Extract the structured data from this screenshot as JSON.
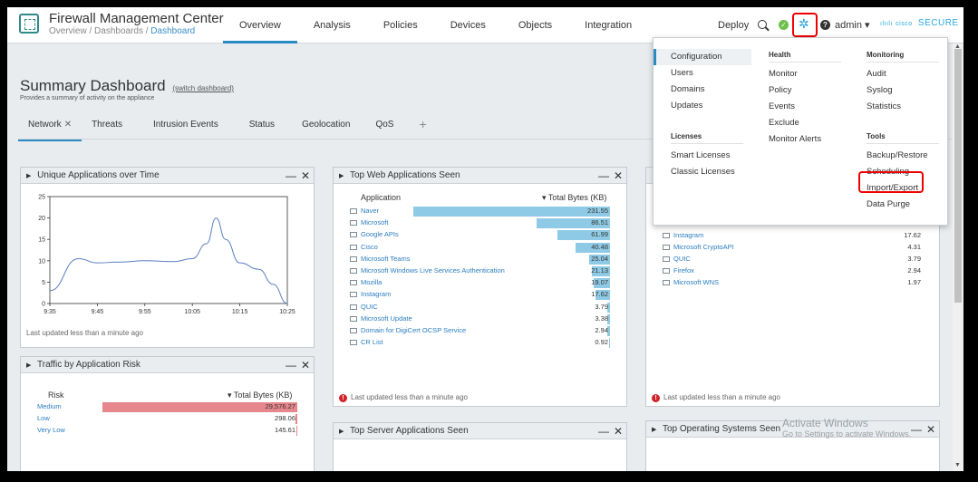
{
  "header": {
    "app_title": "Firewall Management Center",
    "breadcrumb": [
      "Overview",
      "Dashboards",
      "Dashboard"
    ],
    "nav": [
      "Overview",
      "Analysis",
      "Policies",
      "Devices",
      "Objects",
      "Integration"
    ],
    "active_nav": "Overview",
    "deploy": "Deploy",
    "user": "admin ▾",
    "brand_dots": "ılıılı",
    "brand_cisco": "cisco",
    "brand_secure": "SECURE"
  },
  "page": {
    "title": "Summary Dashboard",
    "switch_link": "(switch dashboard)",
    "subtitle": "Provides a summary of activity on the appliance",
    "tabs": [
      "Network",
      "Threats",
      "Intrusion Events",
      "Status",
      "Geolocation",
      "QoS"
    ],
    "active_tab": "Network",
    "add_tab": "+"
  },
  "widgets": {
    "unique_apps": {
      "title": "Unique Applications over Time",
      "updated": "Last updated less than a minute ago"
    },
    "traffic_risk": {
      "title": "Traffic by Application Risk",
      "col_risk": "Risk",
      "col_bytes": "▾ Total Bytes (KB)",
      "rows": [
        {
          "name": "Medium",
          "value": "29,576.27",
          "ratio": 1.0
        },
        {
          "name": "Low",
          "value": "298.06",
          "ratio": 0.01
        },
        {
          "name": "Very Low",
          "value": "145.61",
          "ratio": 0.005
        }
      ]
    },
    "top_web": {
      "title": "Top Web Applications Seen",
      "col_app": "Application",
      "col_bytes": "▾ Total Bytes (KB)",
      "rows": [
        {
          "name": "Naver",
          "value": "231.55",
          "ratio": 1.0
        },
        {
          "name": "Microsoft",
          "value": "86.51",
          "ratio": 0.374
        },
        {
          "name": "Google APIs",
          "value": "61.99",
          "ratio": 0.268
        },
        {
          "name": "Cisco",
          "value": "40.48",
          "ratio": 0.175
        },
        {
          "name": "Microsoft Teams",
          "value": "25.04",
          "ratio": 0.108
        },
        {
          "name": "Microsoft Windows Live Services Authentication",
          "value": "21.13",
          "ratio": 0.091
        },
        {
          "name": "Mozilla",
          "value": "19.07",
          "ratio": 0.082
        },
        {
          "name": "Instagram",
          "value": "17.62",
          "ratio": 0.076
        },
        {
          "name": "QUIC",
          "value": "3.79",
          "ratio": 0.016
        },
        {
          "name": "Microsoft Update",
          "value": "3.38",
          "ratio": 0.015
        },
        {
          "name": "Domain for DigiCert OCSP Service",
          "value": "2.94",
          "ratio": 0.013
        },
        {
          "name": "CR List",
          "value": "0.92",
          "ratio": 0.004
        }
      ],
      "updated": "Last updated less than a minute ago"
    },
    "third": {
      "rows": [
        {
          "name": "Instagram",
          "value": "17.62"
        },
        {
          "name": "Microsoft CryptoAPI",
          "value": "4.31"
        },
        {
          "name": "QUIC",
          "value": "3.79"
        },
        {
          "name": "Firefox",
          "value": "2.94"
        },
        {
          "name": "Microsoft WNS",
          "value": "1.97"
        }
      ],
      "updated": "Last updated less than a minute ago"
    },
    "top_server": {
      "title": "Top Server Applications Seen"
    },
    "top_os": {
      "title": "Top Operating Systems Seen"
    }
  },
  "menu": {
    "configuration": {
      "items": [
        "Configuration",
        "Users",
        "Domains",
        "Updates"
      ]
    },
    "health": {
      "heading": "Health",
      "items": [
        "Monitor",
        "Policy",
        "Events",
        "Exclude",
        "Monitor Alerts"
      ]
    },
    "monitoring": {
      "heading": "Monitoring",
      "items": [
        "Audit",
        "Syslog",
        "Statistics"
      ]
    },
    "licenses": {
      "heading": "Licenses",
      "items": [
        "Smart Licenses",
        "Classic Licenses"
      ]
    },
    "tools": {
      "heading": "Tools",
      "items": [
        "Backup/Restore",
        "Scheduling",
        "Import/Export",
        "Data Purge"
      ]
    }
  },
  "watermark": {
    "line1": "Activate Windows",
    "line2": "Go to Settings to activate Windows."
  },
  "chart_data": {
    "type": "line",
    "title": "Unique Applications over Time",
    "x": [
      "9:35",
      "9:45",
      "9:55",
      "10:05",
      "10:15",
      "10:25"
    ],
    "y_ticks": [
      0,
      5,
      10,
      15,
      20,
      25
    ],
    "ylim": [
      0,
      25
    ],
    "series": [
      {
        "points": [
          {
            "t": 0.0,
            "v": 3
          },
          {
            "t": 0.12,
            "v": 10.5
          },
          {
            "t": 0.2,
            "v": 9.5
          },
          {
            "t": 0.3,
            "v": 9.7
          },
          {
            "t": 0.4,
            "v": 10
          },
          {
            "t": 0.52,
            "v": 9.8
          },
          {
            "t": 0.6,
            "v": 10.5
          },
          {
            "t": 0.66,
            "v": 14
          },
          {
            "t": 0.7,
            "v": 20
          },
          {
            "t": 0.74,
            "v": 15
          },
          {
            "t": 0.8,
            "v": 9.5
          },
          {
            "t": 0.88,
            "v": 8
          },
          {
            "t": 0.94,
            "v": 4.5
          },
          {
            "t": 1.0,
            "v": 0
          }
        ]
      }
    ]
  }
}
